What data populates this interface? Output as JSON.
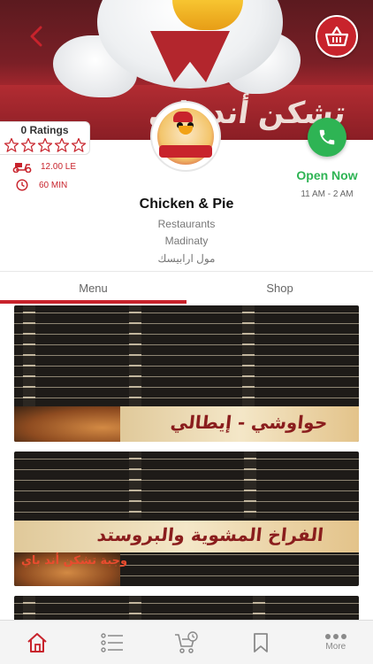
{
  "header": {
    "cover_sign_text": "تشكن أند باي",
    "back_icon": "chevron-left-icon",
    "basket_icon": "basket-icon"
  },
  "restaurant": {
    "ratings_text": "0 Ratings",
    "stars_total": 5,
    "stars_filled": 0,
    "delivery_fee": "12.00  LE",
    "delivery_time": "60 MIN",
    "name": "Chicken & Pie",
    "category": "Restaurants",
    "area": "Madinaty",
    "location": "مول ارابيسك",
    "status": "Open Now",
    "hours": "11 AM - 2 AM",
    "logo_text": "تشكن أند باي"
  },
  "tabs": [
    {
      "label": "Menu",
      "active": true
    },
    {
      "label": "Shop",
      "active": false
    }
  ],
  "menu_images": {
    "banner_1": "حواوشي - إيطالي",
    "banner_2": "الفراخ المشوية والبروستد",
    "promo": "وجبة تشكن أند باي"
  },
  "bottom_nav": {
    "items": [
      {
        "icon": "home-icon",
        "label": "",
        "active": true
      },
      {
        "icon": "list-icon",
        "label": "",
        "active": false
      },
      {
        "icon": "cart-clock-icon",
        "label": "",
        "active": false
      },
      {
        "icon": "bookmark-icon",
        "label": "",
        "active": false
      },
      {
        "icon": "more-icon",
        "label": "More",
        "active": false
      }
    ]
  },
  "colors": {
    "brand_red": "#c8232c",
    "open_green": "#2eb454",
    "muted_text": "#777777"
  }
}
